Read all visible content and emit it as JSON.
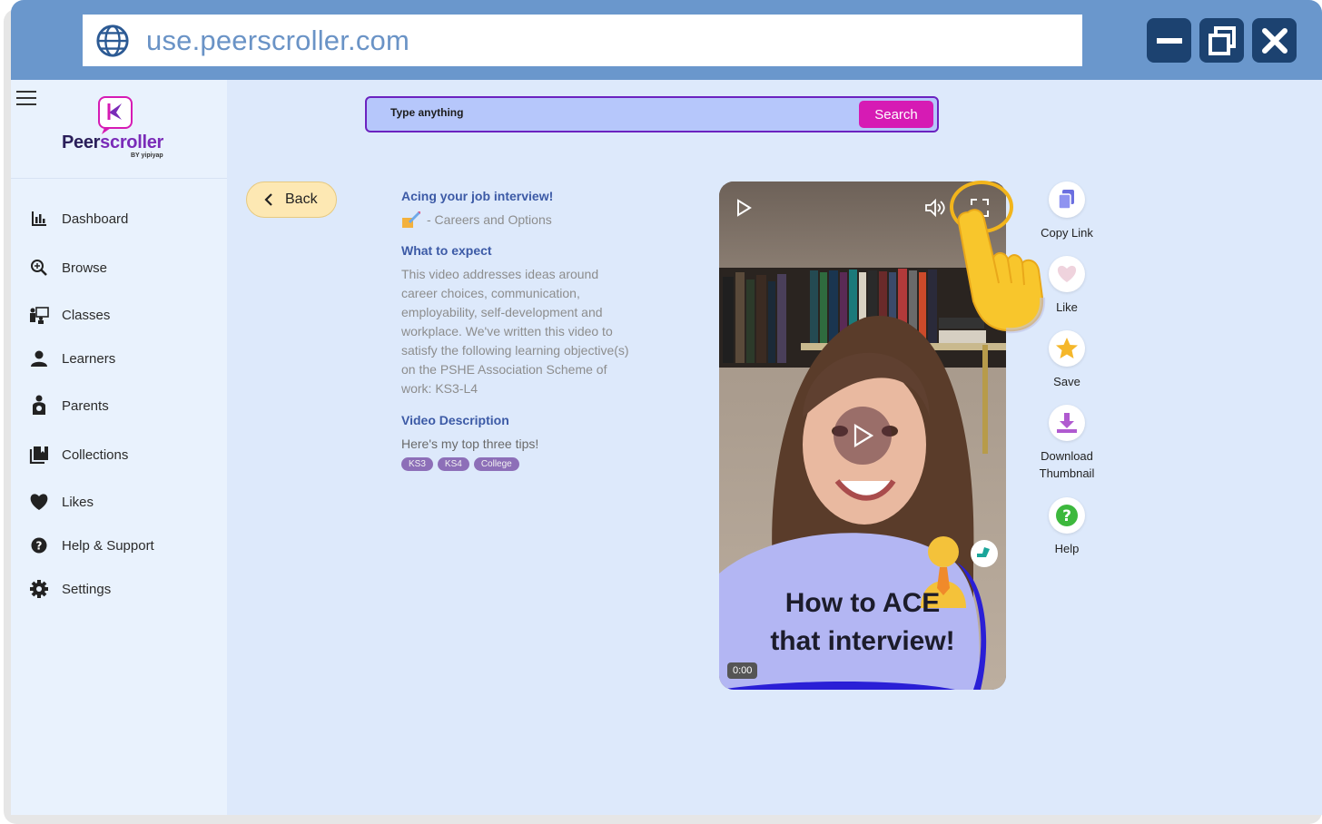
{
  "browser": {
    "url": "use.peerscroller.com"
  },
  "window_controls": {
    "minimize": "minimize-icon",
    "restore": "restore-icon",
    "close": "close-icon"
  },
  "brand": {
    "name_a": "Peer",
    "name_b": "scroller",
    "byline": "BY yipiyap"
  },
  "sidebar": {
    "items": [
      {
        "label": "Dashboard",
        "icon": "bar-chart-icon"
      },
      {
        "label": "Browse",
        "icon": "search-zoom-icon"
      },
      {
        "label": "Classes",
        "icon": "classroom-icon"
      },
      {
        "label": "Learners",
        "icon": "person-icon"
      },
      {
        "label": "Parents",
        "icon": "parent-icon"
      },
      {
        "label": "Collections",
        "icon": "collection-icon"
      },
      {
        "label": "Likes",
        "icon": "heart-icon"
      },
      {
        "label": "Help & Support",
        "icon": "question-icon"
      },
      {
        "label": "Settings",
        "icon": "gear-icon"
      }
    ]
  },
  "search": {
    "placeholder": "Type anything",
    "button_label": "Search"
  },
  "back": {
    "label": "Back"
  },
  "video_info": {
    "title": "Acing your job interview!",
    "category": "- Careers and Options",
    "expect_heading": "What to expect",
    "expect_text": "This video addresses ideas around career choices, communication, employability, self-development and workplace. We've written this video to satisfy the following learning objective(s) on the PSHE Association Scheme of work: KS3-L4",
    "description_heading": "Video Description",
    "description": "Here's my top three tips!",
    "tags": [
      "KS3",
      "KS4",
      "College"
    ]
  },
  "video": {
    "overlay_title_line1": "How to ACE",
    "overlay_title_line2": "that interview!",
    "time": "0:00"
  },
  "actions": [
    {
      "label": "Copy Link",
      "icon": "copy-icon"
    },
    {
      "label": "Like",
      "icon": "heart-icon"
    },
    {
      "label": "Save",
      "icon": "star-icon"
    },
    {
      "label": "Download Thumbnail",
      "icon": "download-icon"
    },
    {
      "label": "Help",
      "icon": "help-icon"
    }
  ],
  "colors": {
    "accent": "#d61bb4",
    "title_bar": "#6a97cc",
    "link_blue": "#3c5aa6"
  }
}
